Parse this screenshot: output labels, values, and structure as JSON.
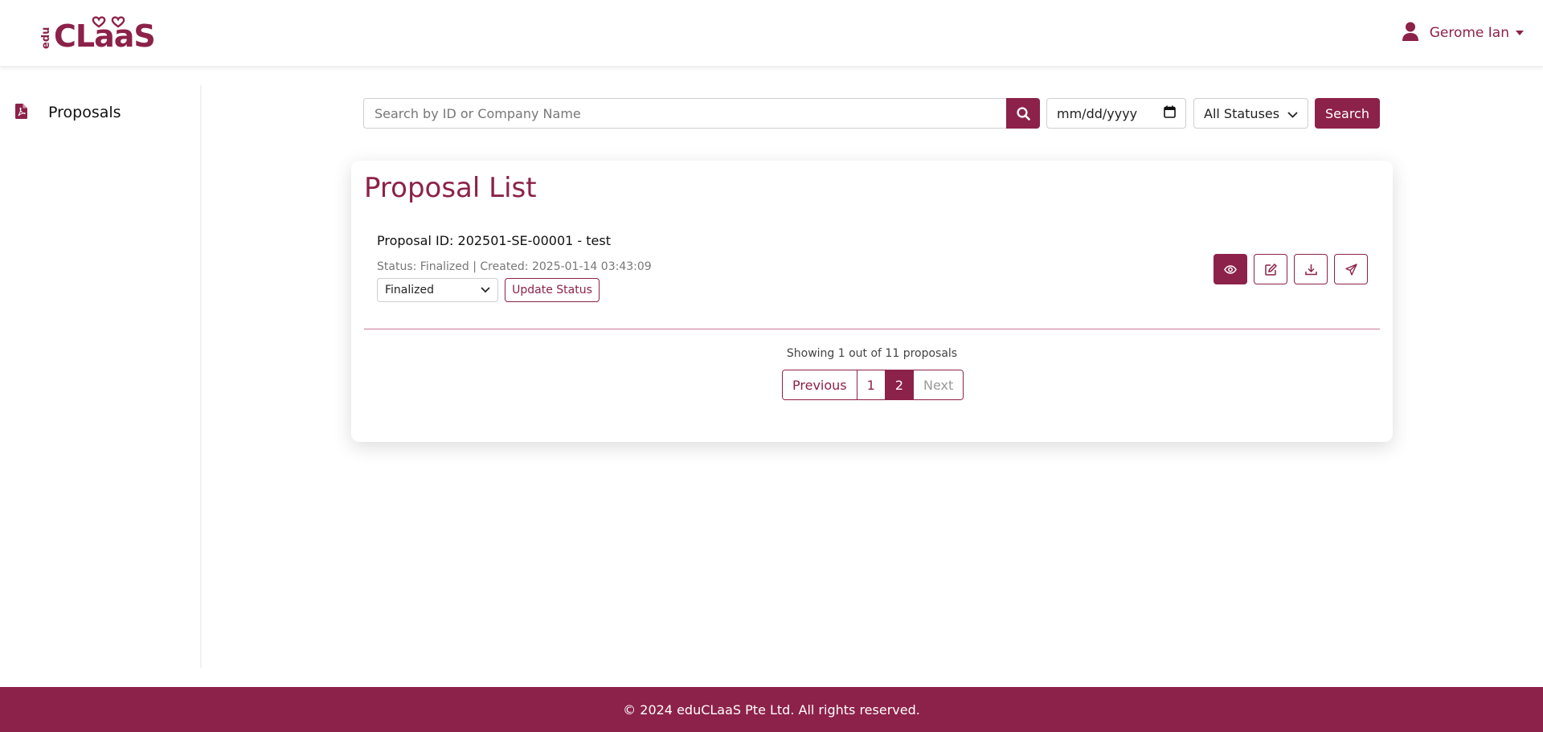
{
  "header": {
    "logo_text": "eduCLaaS",
    "user_name": "Gerome Ian"
  },
  "sidebar": {
    "items": [
      {
        "label": "Proposals",
        "icon": "file-pdf-icon"
      }
    ]
  },
  "filters": {
    "search_placeholder": "Search by ID or Company Name",
    "date_placeholder": "mm/dd/yyyy",
    "status_selected": "All Statuses",
    "search_button": "Search"
  },
  "card": {
    "title": "Proposal List",
    "proposal": {
      "id_line": "Proposal ID: 202501-SE-00001 - test",
      "meta_line": "Status: Finalized | Created: 2025-01-14 03:43:09",
      "status_selected": "Finalized",
      "update_button": "Update Status"
    },
    "actions": [
      "view-icon",
      "edit-icon",
      "download-icon",
      "send-icon"
    ],
    "showing_text": "Showing 1 out of 11 proposals",
    "pagination": {
      "previous": "Previous",
      "pages": [
        "1",
        "2"
      ],
      "active_page": "2",
      "next": "Next"
    }
  },
  "footer": {
    "text": "© 2024 eduCLaaS Pte Ltd. All rights reserved."
  },
  "colors": {
    "brand": "#8c2149"
  }
}
